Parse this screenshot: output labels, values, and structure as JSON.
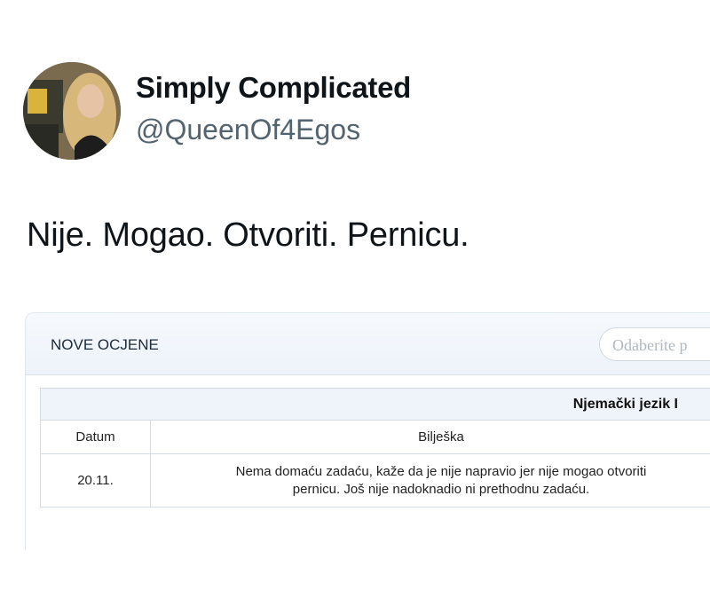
{
  "tweet": {
    "display_name": "Simply Complicated",
    "handle": "@QueenOf4Egos",
    "text": "Nije. Mogao. Otvoriti. Pernicu."
  },
  "embed": {
    "title": "NOVE OCJENE",
    "select_placeholder": "Odaberite p",
    "table": {
      "subject": "Njemački jezik I",
      "columns": [
        "Datum",
        "Bilješka"
      ],
      "rows": [
        {
          "date": "20.11.",
          "note_line1": "Nema domaću zadaću, kaže da je nije napravio jer nije mogao otvoriti",
          "note_line2": "pernicu. Još nije nadoknadio ni prethodnu zadaću."
        }
      ]
    }
  }
}
